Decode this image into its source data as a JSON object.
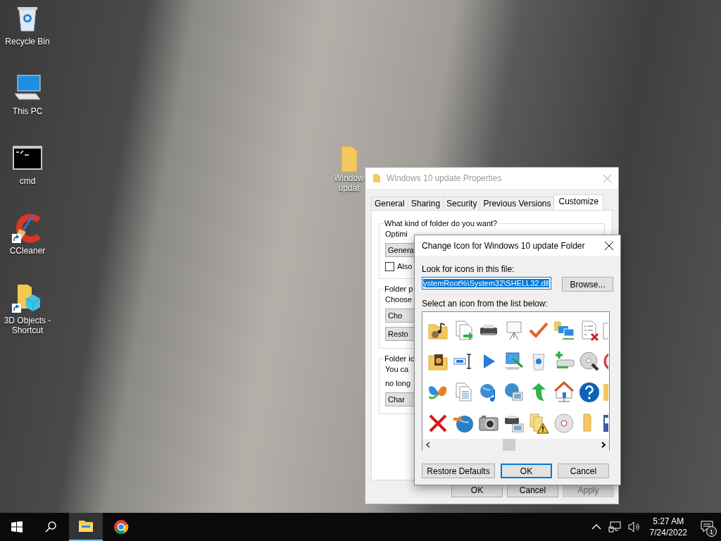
{
  "desktop": {
    "icons": [
      {
        "label": "Recycle Bin",
        "kind": "recycle-bin",
        "shortcut": false
      },
      {
        "label": "This PC",
        "kind": "computer",
        "shortcut": false
      },
      {
        "label": "cmd",
        "kind": "console",
        "shortcut": false
      },
      {
        "label": "CCleaner",
        "kind": "cleaner",
        "shortcut": true
      },
      {
        "label": "3D Objects - Shortcut",
        "kind": "objects-3d",
        "shortcut": true
      }
    ],
    "folder_item": {
      "label_lines": [
        "Window",
        "updat"
      ]
    }
  },
  "properties_window": {
    "title": "Windows 10 update Properties",
    "active": false,
    "tabs": [
      {
        "label": "General",
        "selected": false
      },
      {
        "label": "Sharing",
        "selected": false
      },
      {
        "label": "Security",
        "selected": false
      },
      {
        "label": "Previous Versions",
        "selected": false
      },
      {
        "label": "Customize",
        "selected": true
      }
    ],
    "groups": [
      {
        "title": "What kind of folder do you want?",
        "items": [
          {
            "kind": "text",
            "text": "Optimi"
          },
          {
            "kind": "dropdown",
            "text": "Genera"
          },
          {
            "kind": "checkbox",
            "text": "Also",
            "checked": false
          }
        ]
      },
      {
        "title": "Folder p",
        "items": [
          {
            "kind": "text",
            "text": "Choose"
          },
          {
            "kind": "button",
            "text": "Cho"
          },
          {
            "kind": "button",
            "text": "Resto"
          }
        ]
      },
      {
        "title": "Folder ic",
        "items": [
          {
            "kind": "text",
            "text": "You ca"
          },
          {
            "kind": "text",
            "text": "no long"
          },
          {
            "kind": "button",
            "text": "Char"
          }
        ]
      }
    ],
    "buttons": [
      {
        "label": "OK",
        "disabled": false
      },
      {
        "label": "Cancel",
        "disabled": false
      },
      {
        "label": "Apply",
        "disabled": true
      }
    ]
  },
  "change_icon_dialog": {
    "title": "Change Icon for Windows 10 update Folder",
    "file_label": "Look for icons in this file:",
    "file_path": {
      "value": "ystemRoot%\\System32\\SHELL32.dll",
      "selected": true
    },
    "browse_button": "Browse...",
    "list_label": "Select an icon from the list below:",
    "buttons": [
      {
        "label": "Restore Defaults",
        "default": false
      },
      {
        "label": "OK",
        "default": true
      },
      {
        "label": "Cancel",
        "default": false
      }
    ]
  },
  "taskbar": {
    "apps": [
      {
        "kind": "file-explorer",
        "active": true
      },
      {
        "kind": "chrome",
        "active": false
      }
    ],
    "time": "5:27 AM",
    "date": "7/24/2022",
    "notification_count": "1"
  }
}
